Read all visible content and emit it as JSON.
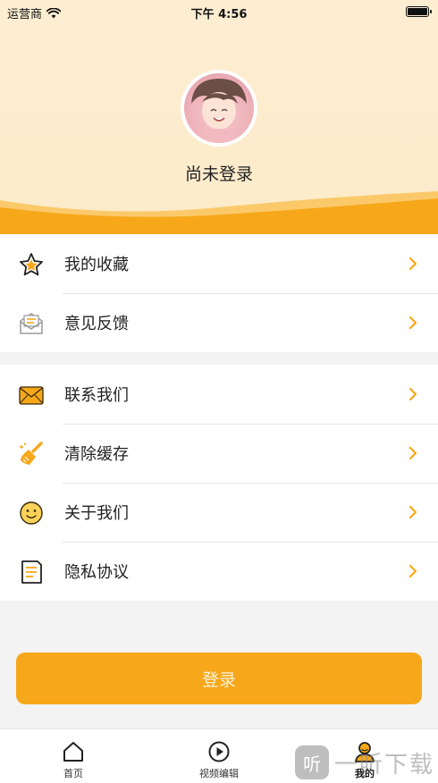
{
  "status_bar": {
    "carrier": "运营商",
    "time": "下午 4:56"
  },
  "profile": {
    "username": "尚未登录"
  },
  "menu_group_1": [
    {
      "label": "我的收藏",
      "icon": "star-icon"
    },
    {
      "label": "意见反馈",
      "icon": "feedback-envelope-icon"
    }
  ],
  "menu_group_2": [
    {
      "label": "联系我们",
      "icon": "mail-icon"
    },
    {
      "label": "清除缓存",
      "icon": "broom-icon"
    },
    {
      "label": "关于我们",
      "icon": "smiley-icon"
    },
    {
      "label": "隐私协议",
      "icon": "document-icon"
    }
  ],
  "login_button": {
    "label": "登录"
  },
  "tabbar": [
    {
      "label": "首页",
      "icon": "home-icon"
    },
    {
      "label": "视频编辑",
      "icon": "play-circle-icon"
    },
    {
      "label": "我的",
      "icon": "user-icon",
      "active": true
    }
  ],
  "watermark": {
    "text": "一听下载",
    "logo_text": "听"
  },
  "colors": {
    "accent": "#f6a81a",
    "header_bg": "#fdeed2",
    "background": "#f3f3f3"
  }
}
